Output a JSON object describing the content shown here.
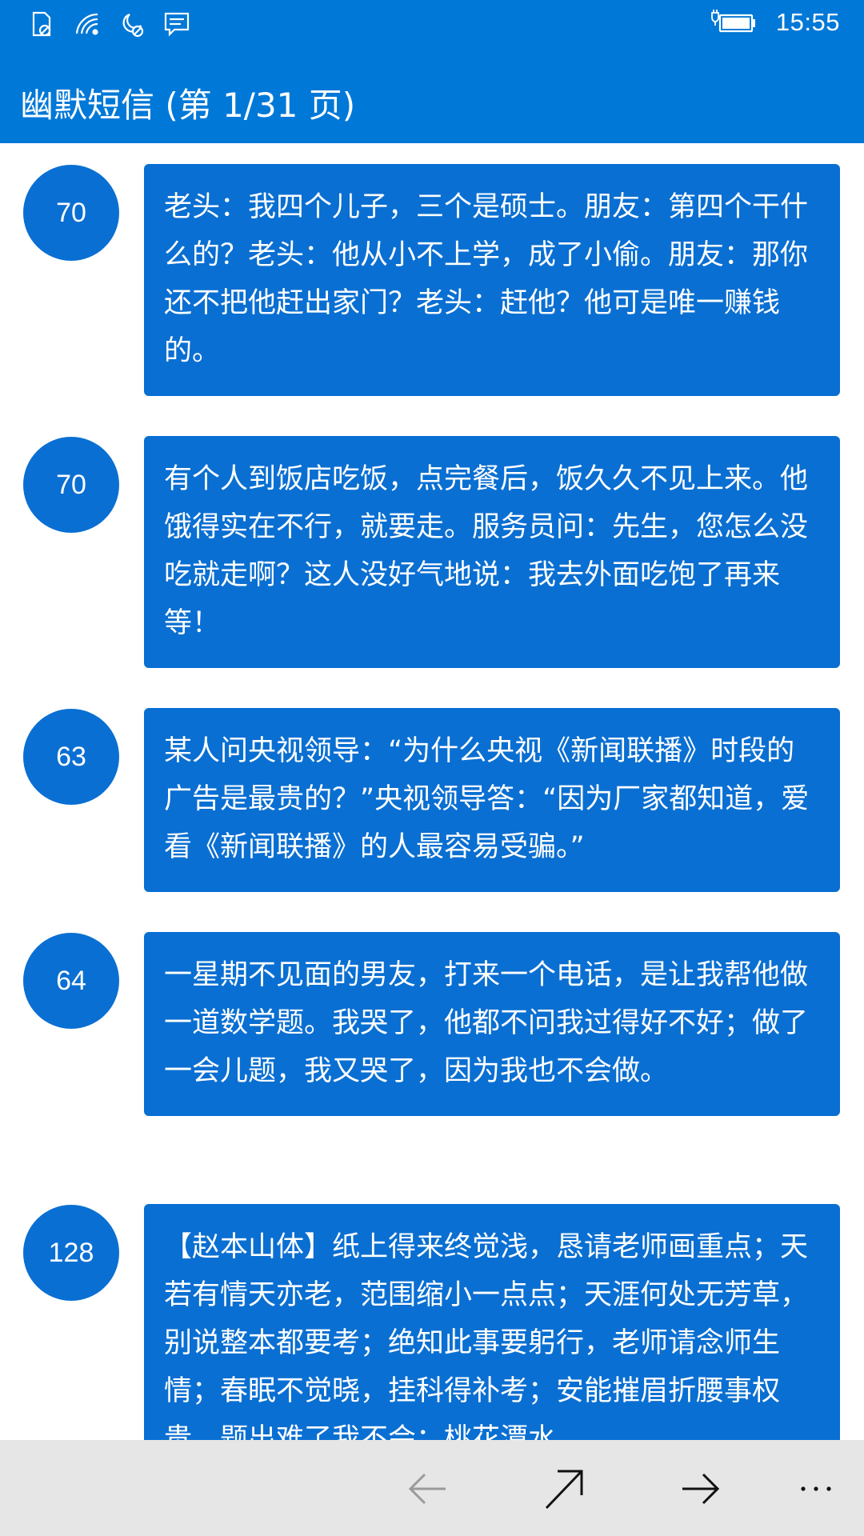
{
  "status_bar": {
    "time": "15:55",
    "icons": [
      "sim-missing-icon",
      "wifi-icon",
      "quiet-hours-icon",
      "message-notification-icon",
      "battery-charging-icon"
    ]
  },
  "header": {
    "title": "幽默短信 (第 1/31 页)"
  },
  "messages": [
    {
      "count": "70",
      "text": "老头：我四个儿子，三个是硕士。朋友：第四个干什么的？老头：他从小不上学，成了小偷。朋友：那你还不把他赶出家门？老头：赶他？他可是唯一赚钱的。"
    },
    {
      "count": "70",
      "text": "有个人到饭店吃饭，点完餐后，饭久久不见上来。他饿得实在不行，就要走。服务员问：先生，您怎么没吃就走啊？这人没好气地说：我去外面吃饱了再来等！"
    },
    {
      "count": "63",
      "text": "某人问央视领导：“为什么央视《新闻联播》时段的广告是最贵的？”央视领导答：“因为厂家都知道，爱看《新闻联播》的人最容易受骗。”"
    },
    {
      "count": "64",
      "text": "一星期不见面的男友，打来一个电话，是让我帮他做一道数学题。我哭了，他都不问我过得好不好；做了一会儿题，我又哭了，因为我也不会做。"
    },
    {
      "count": "128",
      "text": "【赵本山体】纸上得来终觉浅，恳请老师画重点；天若有情天亦老，范围缩小一点点；天涯何处无芳草，别说整本都要考；绝知此事要躬行，老师请念师生情；春眠不觉晓，挂科得补考；安能摧眉折腰事权贵，题出难了我不会；桃花潭水"
    }
  ],
  "app_bar": {
    "buttons": [
      "back-arrow-icon",
      "share-arrow-icon",
      "forward-arrow-icon",
      "more-icon"
    ]
  },
  "colors": {
    "accent": "#0078d7",
    "bubble": "#0a6fd2",
    "app_bar": "#e6e6e6"
  }
}
